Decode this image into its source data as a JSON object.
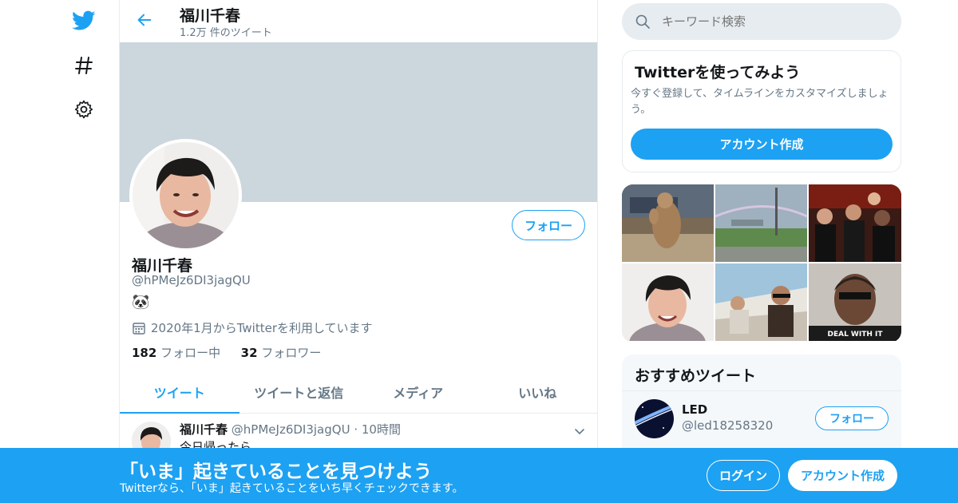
{
  "colors": {
    "accent": "#1da1f2",
    "banner": "#ccd6dd",
    "muted": "#657786",
    "text": "#14171a"
  },
  "nav": {
    "icons": [
      "twitter-bird-icon",
      "hashtag-icon",
      "gear-icon"
    ]
  },
  "header": {
    "title": "福川千春",
    "subtitle": "1.2万 件のツイート"
  },
  "profile": {
    "name": "福川千春",
    "handle": "@hPMeJz6DI3jagQU",
    "bio": "🐼",
    "joined": "2020年1月からTwitterを利用しています",
    "following_count": "182",
    "following_label": "フォロー中",
    "followers_count": "32",
    "followers_label": "フォロワー",
    "follow_label": "フォロー"
  },
  "tabs": [
    {
      "label": "ツイート",
      "active": true
    },
    {
      "label": "ツイートと返信",
      "active": false
    },
    {
      "label": "メディア",
      "active": false
    },
    {
      "label": "いいね",
      "active": false
    }
  ],
  "tweet": {
    "name": "福川千春",
    "handle": "@hPMeJz6DI3jagQU",
    "separator": "·",
    "time": "10時間",
    "text": "今日帰ったら"
  },
  "search": {
    "placeholder": "キーワード検索"
  },
  "signup_card": {
    "title": "Twitterを使ってみよう",
    "description": "今すぐ登録して、タイムラインをカスタマイズしましょう。",
    "button": "アカウント作成"
  },
  "media_grid": {
    "caption_text": "DEAL WITH IT"
  },
  "recommended": {
    "title": "おすすめツイート",
    "user_name": "LED",
    "user_handle": "@led18258320",
    "follow_label": "フォロー"
  },
  "bottom_bar": {
    "title": "「いま」起きていることを見つけよう",
    "subtitle": "Twitterなら、「いま」起きていることをいち早くチェックできます。",
    "login": "ログイン",
    "signup": "アカウント作成"
  }
}
